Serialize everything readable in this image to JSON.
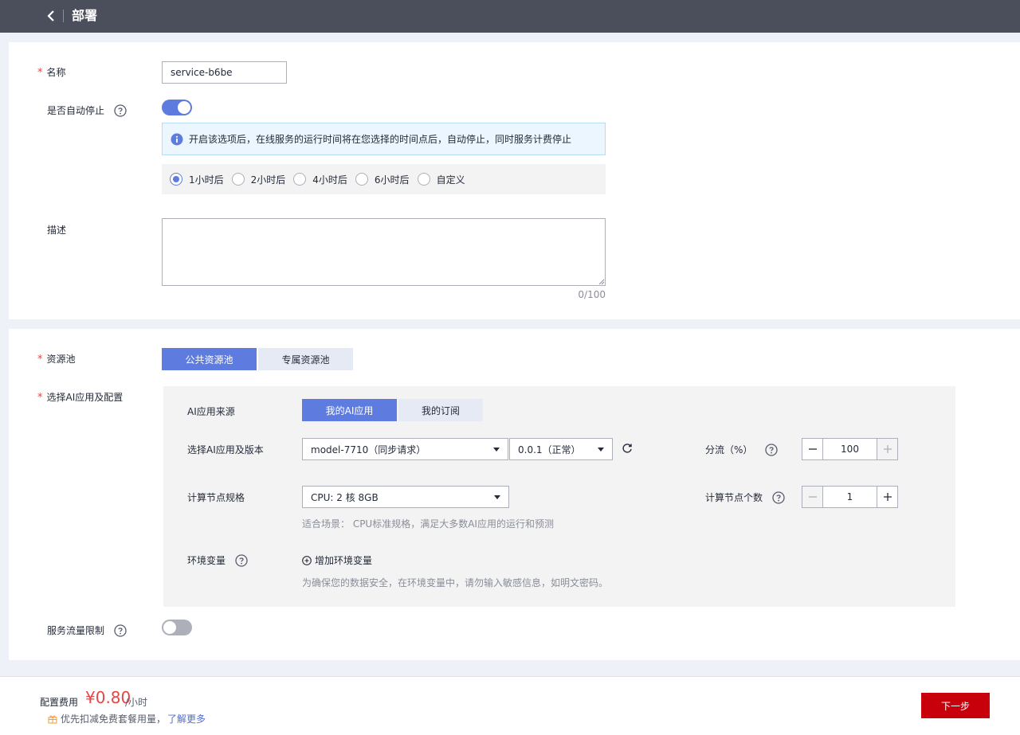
{
  "header": {
    "title": "部署"
  },
  "basic": {
    "name_label": "名称",
    "name_value": "service-b6be",
    "autostop_label": "是否自动停止",
    "autostop_on": true,
    "autostop_info": "开启该选项后，在线服务的运行时间将在您选择的时间点后，自动停止，同时服务计费停止",
    "autostop_options": [
      "1小时后",
      "2小时后",
      "4小时后",
      "6小时后",
      "自定义"
    ],
    "autostop_selected": "1小时后",
    "desc_label": "描述",
    "desc_value": "",
    "desc_counter": "0/100"
  },
  "resource": {
    "pool_label": "资源池",
    "pool_tabs": [
      "公共资源池",
      "专属资源池"
    ],
    "pool_selected": "公共资源池",
    "app_label": "选择AI应用及配置",
    "source_label": "AI应用来源",
    "source_tabs": [
      "我的AI应用",
      "我的订阅"
    ],
    "source_selected": "我的AI应用",
    "version_label": "选择AI应用及版本",
    "model_value": "model-7710（同步请求）",
    "version_value": "0.0.1（正常）",
    "split_label": "分流（%）",
    "split_value": "100",
    "spec_label": "计算节点规格",
    "spec_value": "CPU: 2 核 8GB",
    "spec_hint": "适合场景： CPU标准规格，满足大多数AI应用的运行和预测",
    "nodes_label": "计算节点个数",
    "nodes_value": "1",
    "env_label": "环境变量",
    "env_add": "增加环境变量",
    "env_hint": "为确保您的数据安全，在环境变量中，请勿输入敏感信息，如明文密码。",
    "traffic_label": "服务流量限制",
    "traffic_on": false
  },
  "footer": {
    "fee_label": "配置费用",
    "fee_amount": "¥0.80",
    "fee_unit": "/小时",
    "promo_text": "优先扣减免费套餐用量，",
    "promo_link": "了解更多",
    "next_button": "下一步"
  },
  "colors": {
    "primary": "#5e7ce0",
    "danger": "#c7000b",
    "price": "#e54545",
    "topbar": "#4b4f5c"
  }
}
